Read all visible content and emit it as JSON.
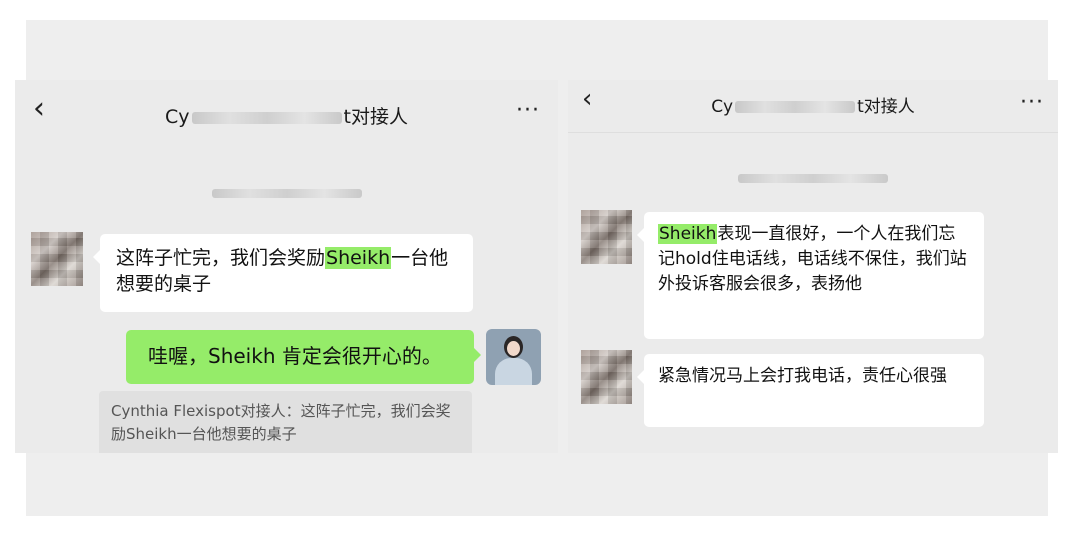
{
  "left": {
    "back_icon": "chevron-left",
    "title_prefix": "Cy",
    "title_suffix": "t对接人",
    "more_label": "···",
    "messages": [
      {
        "pre": "这阵子忙完，我们会奖励",
        "highlight": "Sheikh",
        "post": "一台他想要的桌子"
      },
      {
        "text": "哇喔，Sheikh 肯定会很开心的。"
      }
    ],
    "quote": "Cynthia Flexispot对接人：这阵子忙完，我们会奖励Sheikh一台他想要的桌子"
  },
  "right": {
    "back_icon": "chevron-left",
    "title_prefix": "Cy",
    "title_suffix": "t对接人",
    "more_label": "···",
    "messages": [
      {
        "highlight": "Sheikh",
        "post": "表现一直很好，一个人在我们忘记hold住电话线，电话线不保住，我们站外投诉客服会很多，表扬他"
      },
      {
        "text": "紧急情况马上会打我电话，责任心很强"
      }
    ]
  },
  "colors": {
    "sent_bubble": "#95ec69",
    "received_bubble": "#ffffff",
    "highlight": "#95ec69",
    "panel_bg": "#ebebeb"
  }
}
